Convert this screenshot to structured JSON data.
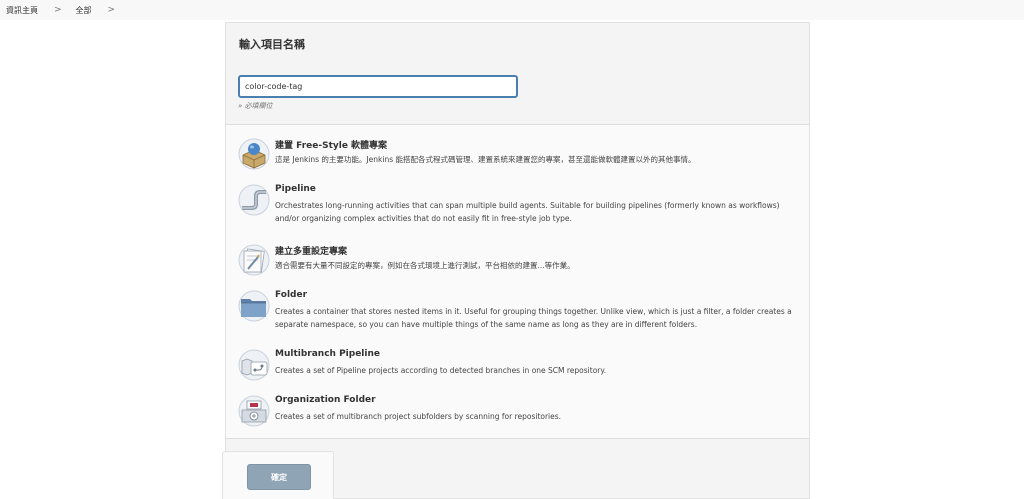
{
  "breadcrumb": {
    "home": "資訊主頁",
    "sep1": ">",
    "all": "全部",
    "sep2": ">"
  },
  "form": {
    "title": "輸入項目名稱",
    "name_value": "color-code-tag",
    "required_note": "» 必填欄位"
  },
  "job_types": [
    {
      "icon": "freestyle-package-icon",
      "title": "建置 Free-Style 軟體專案",
      "description": "這是 Jenkins 的主要功能。Jenkins 能搭配各式程式碼管理、建置系統來建置您的專案，甚至還能做軟體建置以外的其他事情。"
    },
    {
      "icon": "pipeline-icon",
      "title": "Pipeline",
      "description": "Orchestrates long-running activities that can span multiple build agents. Suitable for building pipelines (formerly known as workflows) and/or organizing complex activities that do not easily fit in free-style job type."
    },
    {
      "icon": "multi-config-icon",
      "title": "建立多重設定專案",
      "description": "適合需要有大量不同設定的專案，例如在各式環境上進行測試，平台相依的建置...等作業。"
    },
    {
      "icon": "folder-icon",
      "title": "Folder",
      "description": "Creates a container that stores nested items in it. Useful for grouping things together. Unlike view, which is just a filter, a folder creates a separate namespace, so you can have multiple things of the same name as long as they are in different folders."
    },
    {
      "icon": "multibranch-pipeline-icon",
      "title": "Multibranch Pipeline",
      "description": "Creates a set of Pipeline projects according to detected branches in one SCM repository."
    },
    {
      "icon": "organization-folder-icon",
      "title": "Organization Folder",
      "description": "Creates a set of multibranch project subfolders by scanning for repositories."
    }
  ],
  "actions": {
    "ok_label": "確定"
  },
  "colors": {
    "accent_border": "#4b7fb0",
    "ok_button": "#8fa4b5",
    "panel": "#f4f4f4"
  }
}
